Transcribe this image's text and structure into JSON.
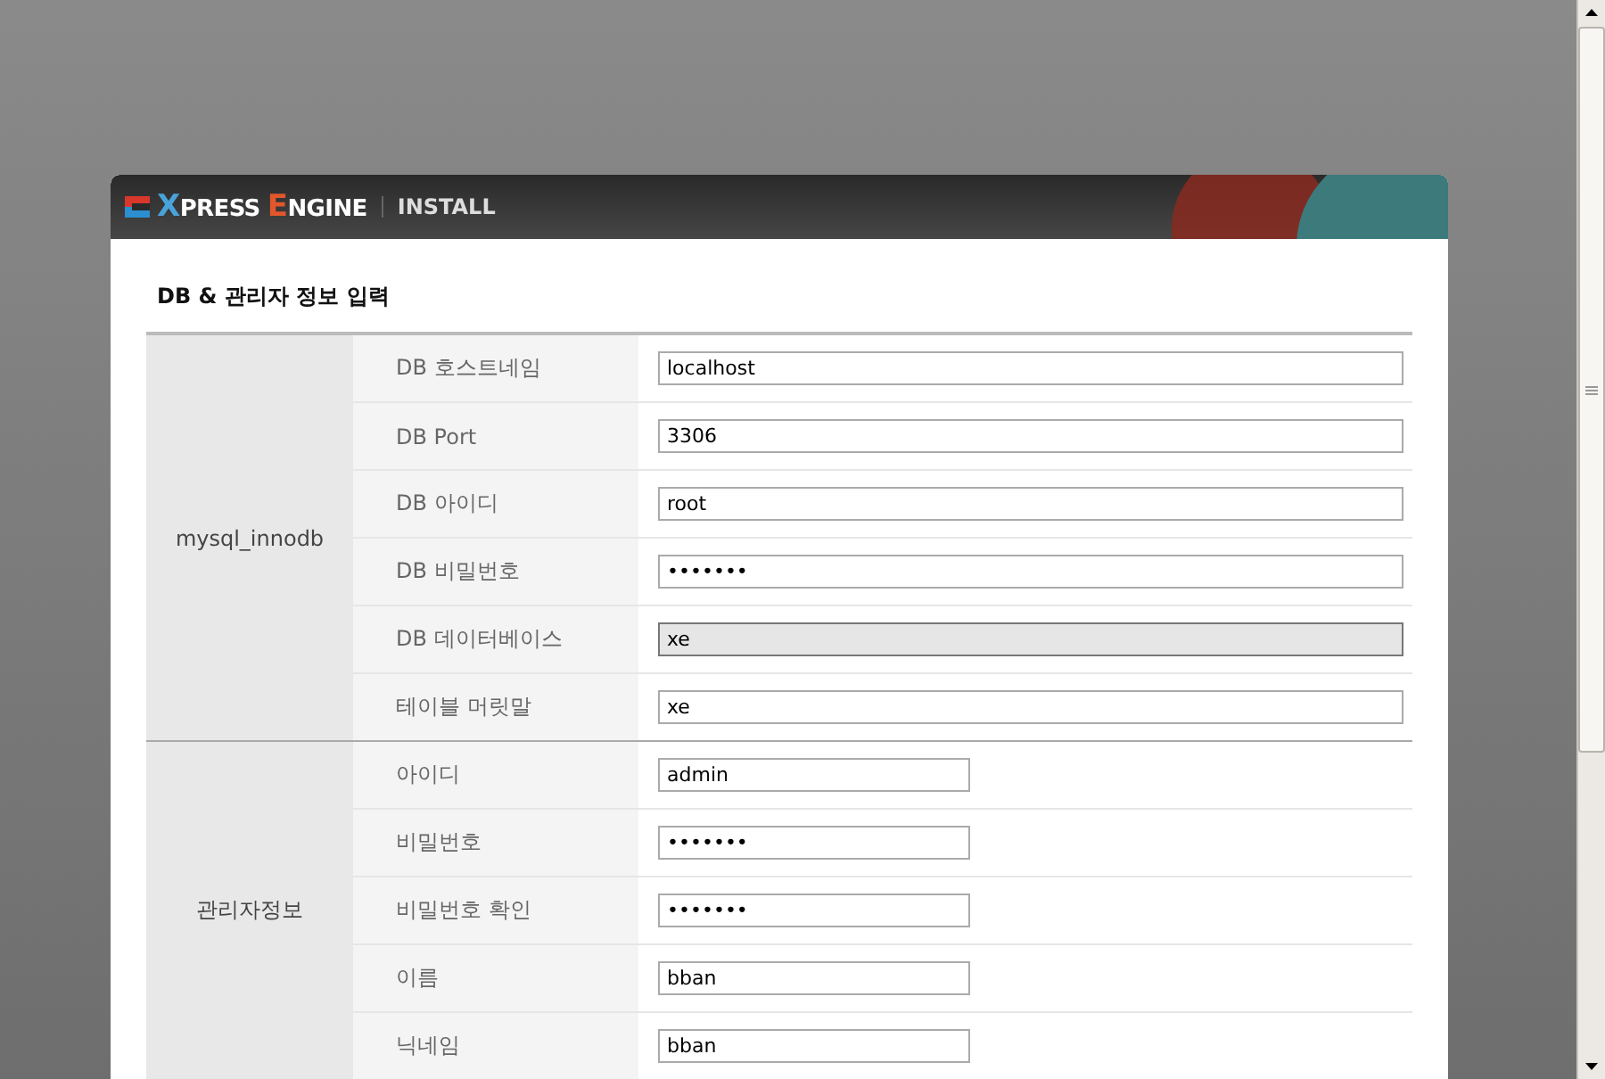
{
  "header": {
    "logo_words": [
      "XPRESS",
      "ENGINE"
    ],
    "section": "INSTALL"
  },
  "title": "DB & 관리자 정보 입력",
  "groups": [
    {
      "name": "mysql_innodb",
      "wide": true,
      "fields": [
        {
          "label": "DB 호스트네임",
          "value": "localhost",
          "focused": false
        },
        {
          "label": "DB Port",
          "value": "3306",
          "focused": false
        },
        {
          "label": "DB 아이디",
          "value": "root",
          "focused": false
        },
        {
          "label": "DB 비밀번호",
          "value": "•••••••",
          "focused": false
        },
        {
          "label": "DB 데이터베이스",
          "value": "xe",
          "focused": true
        },
        {
          "label": "테이블 머릿말",
          "value": "xe",
          "focused": false
        }
      ]
    },
    {
      "name": "관리자정보",
      "wide": false,
      "fields": [
        {
          "label": "아이디",
          "value": "admin",
          "focused": false
        },
        {
          "label": "비밀번호",
          "value": "•••••••",
          "focused": false
        },
        {
          "label": "비밀번호 확인",
          "value": "•••••••",
          "focused": false
        },
        {
          "label": "이름",
          "value": "bban",
          "focused": false
        },
        {
          "label": "닉네임",
          "value": "bban",
          "focused": false
        }
      ]
    }
  ]
}
